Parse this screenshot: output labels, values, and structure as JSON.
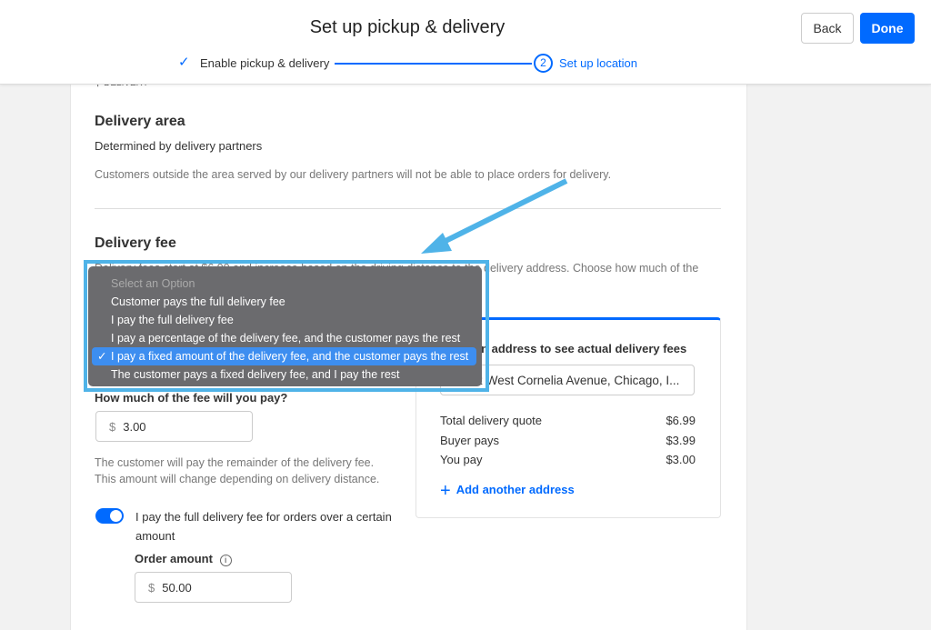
{
  "header": {
    "title": "Set up pickup & delivery",
    "back_label": "Back",
    "done_label": "Done",
    "steps": [
      {
        "label": "Enable pickup & delivery",
        "status": "complete"
      },
      {
        "number": "2",
        "label": "Set up location",
        "status": "current"
      }
    ]
  },
  "section_label": "DELIVERY",
  "delivery_area": {
    "heading": "Delivery area",
    "subtitle": "Determined by delivery partners",
    "note": "Customers outside the area served by our delivery partners will not be able to place orders for delivery."
  },
  "delivery_fee": {
    "heading": "Delivery fee",
    "description": "Delivery fees start at $6.99 and increase based on the driving distance to the delivery address. Choose how much of the",
    "dropdown": {
      "placeholder": "Select an Option",
      "options": [
        "Customer pays the full delivery fee",
        "I pay the full delivery fee",
        "I pay a percentage of the delivery fee, and the customer pays the rest",
        "I pay a fixed amount of the delivery fee, and the customer pays the rest",
        "The customer pays a fixed delivery fee, and I pay the rest"
      ],
      "selected_index": 3
    },
    "amount_label": "How much of the fee will you pay?",
    "currency": "$",
    "amount_value": "3.00",
    "remainder_note_1": "The customer will pay the remainder of the delivery fee.",
    "remainder_note_2": "This amount will change depending on delivery distance.",
    "toggle_label_1": "I pay the full delivery fee for orders over a certain",
    "toggle_label_2": "amount",
    "toggle_on": true,
    "order_amount_label": "Order amount",
    "order_amount_value": "50.00"
  },
  "preview": {
    "heading": "Enter an address to see actual delivery fees",
    "address": "3332 West Cornelia Avenue, Chicago, I...",
    "rows": [
      {
        "label": "Total delivery quote",
        "value": "$6.99"
      },
      {
        "label": "Buyer pays",
        "value": "$3.99"
      },
      {
        "label": "You pay",
        "value": "$3.00"
      }
    ],
    "add_label": "Add another address"
  },
  "colors": {
    "accent": "#006aff",
    "highlight": "#4fb3e8"
  }
}
